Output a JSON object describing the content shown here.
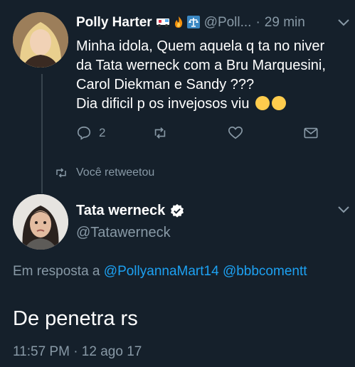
{
  "tweet1": {
    "author_name": "Polly Harter",
    "handle": "@Poll...",
    "separator": "·",
    "time": "29 min",
    "emojis": [
      "ambulance-icon",
      "fire-icon",
      "balance-scale-icon"
    ],
    "text_lines": [
      "Minha idola, Quem aquela q ta no niver",
      "da Tata werneck com a Bru Marquesini,",
      "Carol Diekman e Sandy ???",
      "Dia dificil p os invejosos viu"
    ],
    "reply_count": "2"
  },
  "retweet_label": "Você retweetou",
  "tweet2": {
    "author_name": "Tata werneck",
    "handle": "@Tatawerneck",
    "reply_prefix": "Em resposta a",
    "reply_to_1": "@PollyannaMart14",
    "reply_to_2": "@bbbcomentt",
    "text": "De penetra rs",
    "timestamp": "11:57 PM · 12 ago 17"
  },
  "colors": {
    "background": "#15202b",
    "muted": "#8899a6",
    "link": "#1da1f2",
    "text": "#ffffff"
  }
}
